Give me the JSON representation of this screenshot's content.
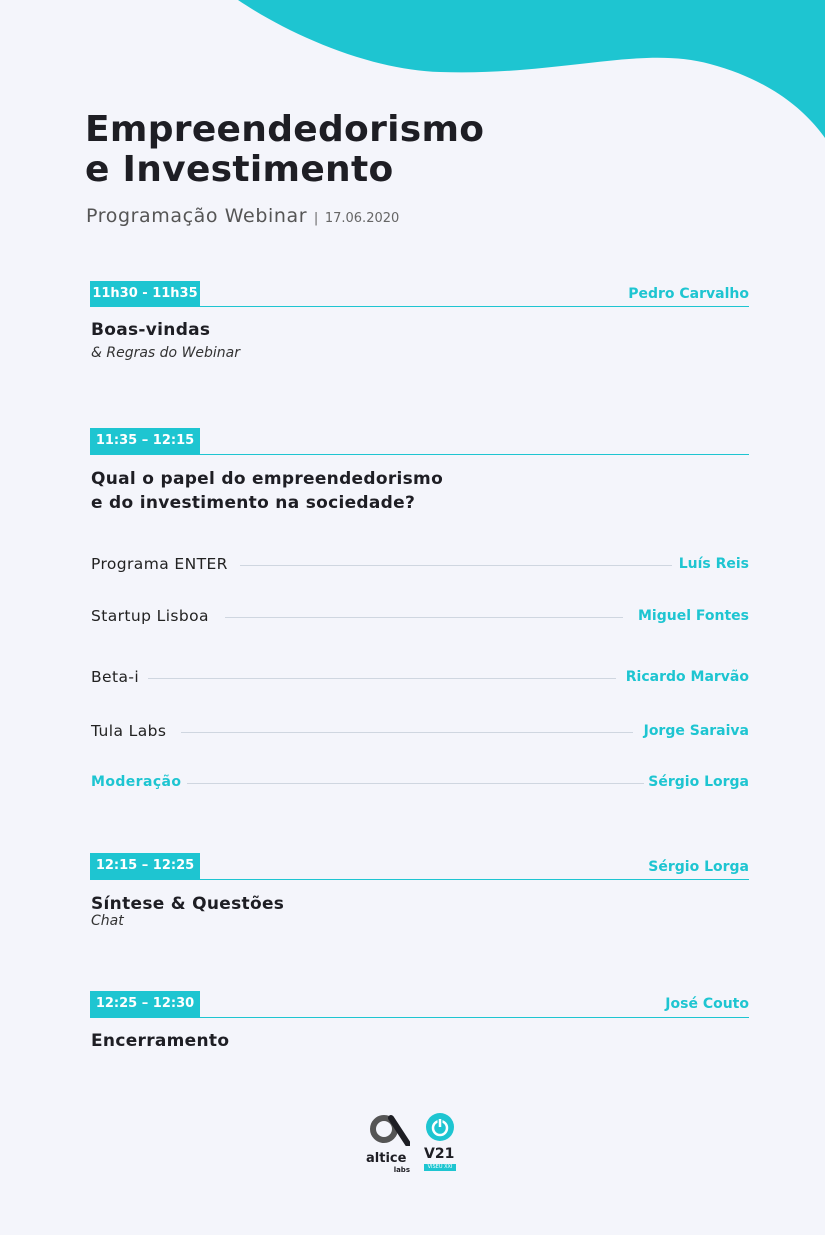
{
  "header": {
    "title_line1": "Empreendedorismo",
    "title_line2": "e Investimento",
    "subtitle": "Programação Webinar",
    "separator": "|",
    "date": "17.06.2020"
  },
  "sessions": [
    {
      "time": "11h30 - 11h35",
      "speaker": "Pedro Carvalho",
      "title": "Boas-vindas",
      "subtitle": "& Regras do Webinar"
    },
    {
      "time": "11:35 – 12:15",
      "title_line1": "Qual o papel do empreendedorismo",
      "title_line2": "e do investimento na sociedade?",
      "rows": [
        {
          "label": "Programa ENTER",
          "speaker": "Luís Reis"
        },
        {
          "label": "Startup Lisboa",
          "speaker": "Miguel Fontes"
        },
        {
          "label": "Beta-i",
          "speaker": "Ricardo Marvão"
        },
        {
          "label": "Tula Labs",
          "speaker": "Jorge Saraiva"
        },
        {
          "label": "Moderação",
          "speaker": "Sérgio Lorga"
        }
      ]
    },
    {
      "time": "12:15 – 12:25",
      "speaker": "Sérgio Lorga",
      "title": "Síntese & Questões",
      "subtitle": "Chat"
    },
    {
      "time": "12:25 – 12:30",
      "speaker": "José Couto",
      "title": "Encerramento"
    }
  ],
  "logos": {
    "altice_name": "altice",
    "altice_sub": "labs",
    "v21_name": "V21",
    "v21_tagline": "VISEU XXI"
  },
  "colors": {
    "accent": "#1ec5d1",
    "background": "#f4f5fb",
    "text": "#1e1e24",
    "divider": "#cfd6e0"
  }
}
